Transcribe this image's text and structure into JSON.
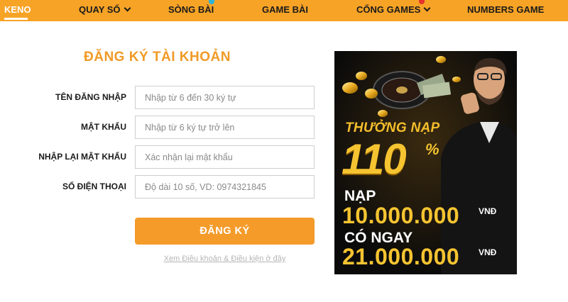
{
  "nav": {
    "items": [
      {
        "label": "KENO",
        "active": true
      },
      {
        "label": "QUAY SỐ",
        "dropdown": true
      },
      {
        "label": "SÒNG BÀI"
      },
      {
        "label": "GAME BÀI"
      },
      {
        "label": "CỔNG GAMES",
        "dropdown": true
      },
      {
        "label": "NUMBERS GAME"
      }
    ],
    "background": "#f7a326"
  },
  "form": {
    "title": "ĐĂNG KÝ TÀI KHOẢN",
    "fields": [
      {
        "label": "TÊN ĐĂNG NHẬP",
        "placeholder": "Nhập từ 6 đến 30 ký tự",
        "value": ""
      },
      {
        "label": "MẬT KHẨU",
        "placeholder": "Nhập từ 6 ký tự trở lên",
        "value": ""
      },
      {
        "label": "NHẬP LẠI MẬT KHẨU",
        "placeholder": "Xác nhận lại mật khẩu",
        "value": ""
      },
      {
        "label": "SỐ ĐIỆN THOẠI",
        "placeholder": "Độ dài 10 số, VD: 0974321845",
        "value": ""
      }
    ],
    "submit_label": "ĐĂNG KÝ",
    "terms_link": "Xem Điều khoản & Điều kiện ở đây",
    "accent": "#f49b2a"
  },
  "banner": {
    "bonus_label": "THƯỞNG NẠP",
    "bonus_value": "110",
    "bonus_unit": "%",
    "deposit_label": "NẠP",
    "deposit_value": "10.000.000",
    "deposit_unit": "VNĐ",
    "receive_label": "CÓ NGAY",
    "receive_value": "21.000.000",
    "receive_unit": "VNĐ"
  }
}
